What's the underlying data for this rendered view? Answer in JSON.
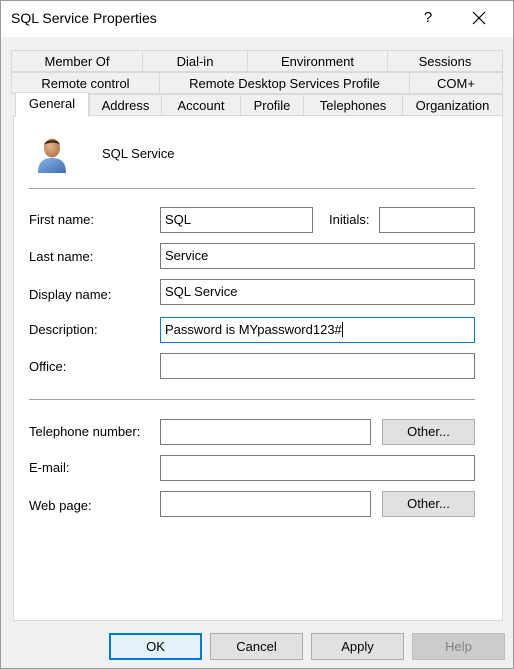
{
  "window": {
    "title": "SQL Service Properties",
    "help_glyph": "?"
  },
  "tabs": {
    "row1": [
      "Member Of",
      "Dial-in",
      "Environment",
      "Sessions"
    ],
    "row2": [
      "Remote control",
      "Remote Desktop Services Profile",
      "COM+"
    ],
    "row3": [
      "General",
      "Address",
      "Account",
      "Profile",
      "Telephones",
      "Organization"
    ],
    "active": "General"
  },
  "general": {
    "display_header": "SQL Service",
    "fields": {
      "first_name": {
        "label": "First name:",
        "value": "SQL"
      },
      "initials": {
        "label": "Initials:",
        "value": ""
      },
      "last_name": {
        "label": "Last name:",
        "value": "Service"
      },
      "display_name": {
        "label": "Display name:",
        "value": "SQL Service"
      },
      "description": {
        "label": "Description:",
        "value": "Password is MYpassword123#"
      },
      "office": {
        "label": "Office:",
        "value": ""
      },
      "telephone": {
        "label": "Telephone number:",
        "value": ""
      },
      "email": {
        "label": "E-mail:",
        "value": ""
      },
      "web_page": {
        "label": "Web page:",
        "value": ""
      }
    },
    "other_button": "Other..."
  },
  "footer": {
    "ok": "OK",
    "cancel": "Cancel",
    "apply": "Apply",
    "help": "Help"
  },
  "colors": {
    "accent": "#0078d7",
    "dialog_bg": "#f0f0f0",
    "panel_bg": "#ffffff"
  },
  "icons": [
    "close-icon",
    "user-avatar-icon"
  ]
}
